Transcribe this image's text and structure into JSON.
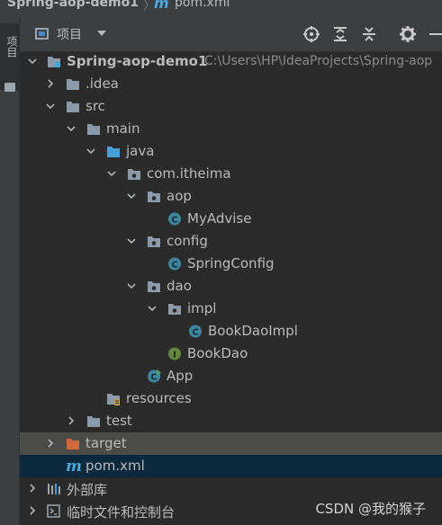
{
  "title_bar": {
    "project": "Spring-aop-demo1",
    "file": "pom.xml"
  },
  "side_stripe": {
    "tab_label": "项目"
  },
  "toolbar": {
    "view_label": "项目"
  },
  "tree": {
    "project": {
      "name": "Spring-aop-demo1",
      "path": "C:\\Users\\HP\\IdeaProjects\\Spring-aop"
    },
    "idea": ".idea",
    "src": "src",
    "main": "main",
    "java": "java",
    "package": "com.itheima",
    "aop": "aop",
    "myadvise": "MyAdvise",
    "config": "config",
    "springconfig": "SpringConfig",
    "dao": "dao",
    "impl": "impl",
    "bookdaoimpl": "BookDaoImpl",
    "bookdao": "BookDao",
    "app": "App",
    "resources": "resources",
    "test": "test",
    "target": "target",
    "pom": "pom.xml",
    "external_libs": "外部库",
    "scratches": "临时文件和控制台"
  },
  "watermark": "CSDN @我的猴子",
  "colors": {
    "folder": "#8b9aa8",
    "source_folder": "#4a9fd6",
    "excluded_folder": "#d06a3a",
    "class_icon": "#3e86a0",
    "interface_icon": "#62873d",
    "maven": "#4ea6dc",
    "selection_blue": "#0d293e",
    "selection_grey": "#4b4b47"
  }
}
